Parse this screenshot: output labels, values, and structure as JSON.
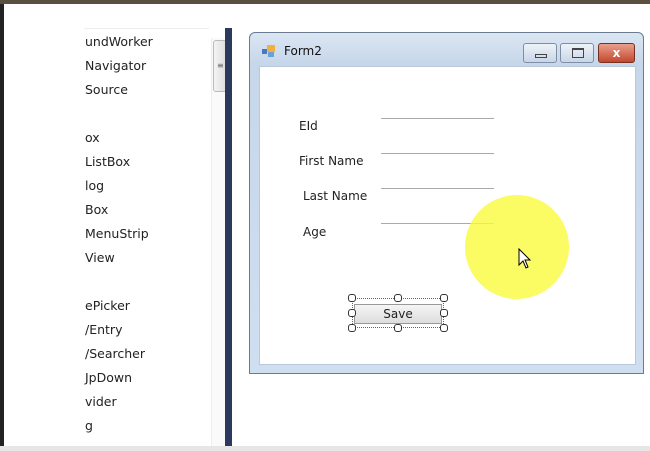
{
  "toolbox": {
    "items": [
      "undWorker",
      "Navigator",
      "Source",
      "",
      "ox",
      "ListBox",
      "log",
      "Box",
      "MenuStrip",
      "View",
      "",
      "ePicker",
      "/Entry",
      "/Searcher",
      "JpDown",
      "vider",
      "g"
    ]
  },
  "form": {
    "title": "Form2",
    "close_glyph": "x",
    "fields": [
      {
        "label": "EId",
        "value": ""
      },
      {
        "label": "First Name",
        "value": ""
      },
      {
        "label": "Last Name",
        "value": ""
      },
      {
        "label": "Age",
        "value": ""
      }
    ],
    "save_label": "Save"
  },
  "colors": {
    "divider": "#2b3a5c",
    "highlight": "#f8f83c",
    "close": "#c4472e"
  }
}
